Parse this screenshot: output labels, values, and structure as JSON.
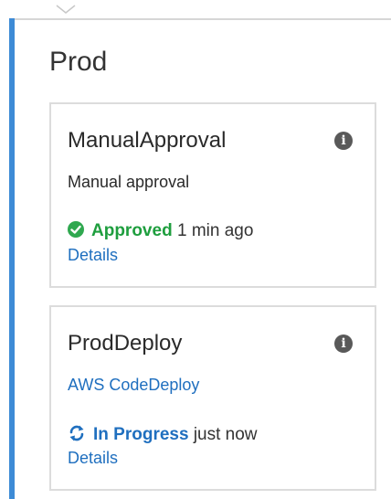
{
  "stage": {
    "name": "Prod",
    "accent_color": "#3d8bd6"
  },
  "actions": [
    {
      "name": "ManualApproval",
      "provider": "Manual approval",
      "status": "Approved",
      "status_color": "#1e9e3e",
      "time": "1 min ago",
      "details_label": "Details",
      "info_icon": "info-icon"
    },
    {
      "name": "ProdDeploy",
      "provider": "AWS CodeDeploy",
      "status": "In Progress",
      "status_color": "#1f6fbf",
      "time": "just now",
      "details_label": "Details",
      "info_icon": "info-icon"
    }
  ],
  "icons": {
    "info_glyph": "i"
  }
}
